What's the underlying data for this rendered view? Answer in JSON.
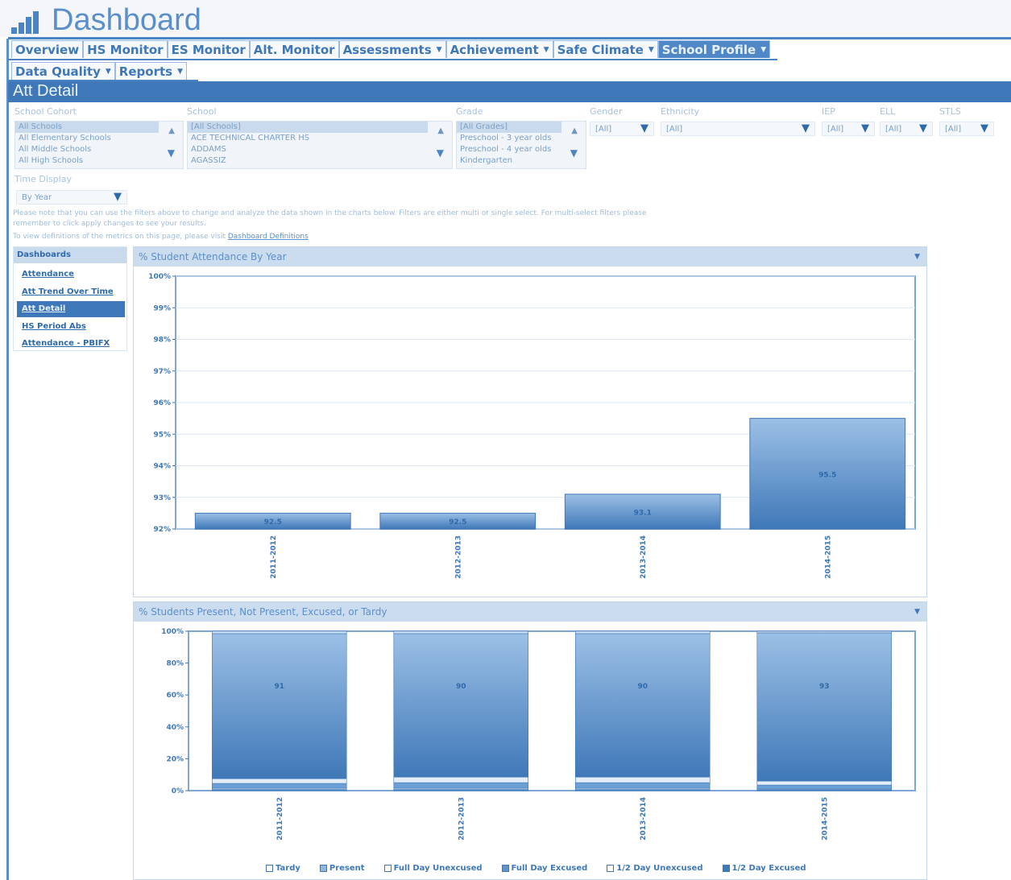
{
  "app": {
    "title": "Dashboard"
  },
  "nav": {
    "row1": [
      {
        "label": "Overview",
        "dropdown": false,
        "active": false
      },
      {
        "label": "HS Monitor",
        "dropdown": false,
        "active": false
      },
      {
        "label": "ES Monitor",
        "dropdown": false,
        "active": false
      },
      {
        "label": "Alt. Monitor",
        "dropdown": false,
        "active": false
      },
      {
        "label": "Assessments",
        "dropdown": true,
        "active": false
      },
      {
        "label": "Achievement",
        "dropdown": true,
        "active": false
      },
      {
        "label": "Safe Climate",
        "dropdown": true,
        "active": false
      },
      {
        "label": "School Profile",
        "dropdown": true,
        "active": true
      }
    ],
    "row2": [
      {
        "label": "Data Quality",
        "dropdown": true,
        "active": false
      },
      {
        "label": "Reports",
        "dropdown": true,
        "active": false
      }
    ]
  },
  "section": {
    "title": "Att Detail"
  },
  "filters": {
    "school_cohort": {
      "label": "School Cohort",
      "options": [
        "All Schools",
        "All Elementary Schools",
        "All Middle Schools",
        "All High Schools"
      ],
      "selected": "All Schools"
    },
    "school": {
      "label": "School",
      "options": [
        "[All Schools]",
        "ACE TECHNICAL CHARTER HS",
        "ADDAMS",
        "AGASSIZ"
      ],
      "selected": "[All Schools]"
    },
    "grade": {
      "label": "Grade",
      "options": [
        "[All Grades]",
        "Preschool - 3 year olds",
        "Preschool - 4 year olds",
        "Kindergarten"
      ],
      "selected": "[All Grades]"
    },
    "gender": {
      "label": "Gender",
      "value": "[All]"
    },
    "ethnicity": {
      "label": "Ethnicity",
      "value": "[All]"
    },
    "iep": {
      "label": "IEP",
      "value": "[All]"
    },
    "ell": {
      "label": "ELL",
      "value": "[All]"
    },
    "stls": {
      "label": "STLS",
      "value": "[All]"
    },
    "time_display": {
      "label": "Time Display",
      "value": "By Year"
    }
  },
  "notes": {
    "line1": "Please note that you can use the filters above to change and analyze the data shown in the charts below. Filters are either multi or single select. For multi-select filters please",
    "line2": "remember to click apply changes to see your results.",
    "line3_prefix": "To view definitions of the metrics on this page, please visit",
    "line3_link": "Dashboard Definitions"
  },
  "sidebar": {
    "heading": "Dashboards",
    "items": [
      {
        "label": "Attendance",
        "active": false
      },
      {
        "label": "Att Trend Over Time",
        "active": false
      },
      {
        "label": "Att Detail",
        "active": true
      },
      {
        "label": "HS Period Abs",
        "active": false
      },
      {
        "label": "Attendance - PBIFX",
        "active": false
      }
    ]
  },
  "colors": {
    "accent": "#3f78b8",
    "bar_light": "#8fb6e0",
    "bar_dark": "#3f78b8",
    "panel_head": "#cbdcee"
  },
  "chart_data": [
    {
      "type": "bar",
      "title": "% Student Attendance By Year",
      "categories": [
        "2011-2012",
        "2012-2013",
        "2013-2014",
        "2014-2015"
      ],
      "values": [
        92.5,
        92.5,
        93.1,
        95.5
      ],
      "ylim": [
        92,
        100
      ],
      "yticks": [
        "92%",
        "93%",
        "94%",
        "95%",
        "96%",
        "97%",
        "98%",
        "99%",
        "100%"
      ],
      "grid": true
    },
    {
      "type": "bar",
      "stacked": true,
      "title": "% Students Present, Not Present, Excused, or Tardy",
      "categories": [
        "2011-2012",
        "2012-2013",
        "2013-2014",
        "2014-2015"
      ],
      "present_labels": [
        "91",
        "90",
        "90",
        "93"
      ],
      "series": [
        {
          "name": "Tardy",
          "values": [
            1.5,
            1.5,
            1.5,
            1
          ]
        },
        {
          "name": "Present",
          "values": [
            91,
            90,
            90,
            93
          ]
        },
        {
          "name": "Full Day Unexcused",
          "values": [
            3,
            3.5,
            3.5,
            2.5
          ]
        },
        {
          "name": "Full Day Excused",
          "values": [
            3,
            3.5,
            3.5,
            2.5
          ]
        },
        {
          "name": "1/2 Day Unexcused",
          "values": [
            0.8,
            0.8,
            0.8,
            0.5
          ]
        },
        {
          "name": "1/2 Day Excused",
          "values": [
            0.7,
            0.7,
            0.7,
            0.5
          ]
        }
      ],
      "ylim": [
        0,
        100
      ],
      "yticks": [
        "0%",
        "20%",
        "40%",
        "60%",
        "80%",
        "100%"
      ],
      "legend": "bottom"
    }
  ]
}
